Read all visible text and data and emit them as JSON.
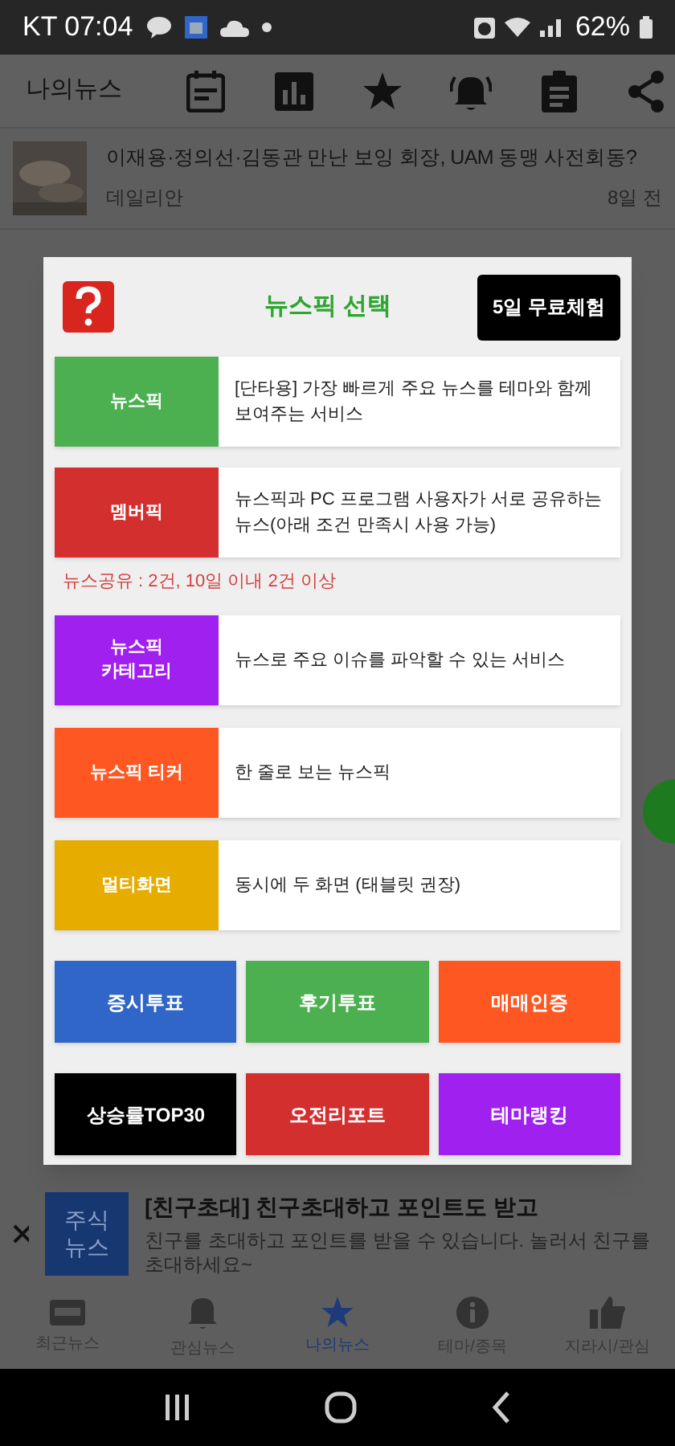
{
  "status_bar": {
    "carrier_time": "KT 07:04",
    "battery": "62%"
  },
  "header": {
    "title": "나의뉴스"
  },
  "news": [
    {
      "title": "이재용·정의선·김동관 만난 보잉 회장, UAM 동맹 사전회동?",
      "source": "데일리안",
      "time": "8일 전"
    }
  ],
  "dialog": {
    "title": "뉴스픽 선택",
    "trial_button": "5일 무료체험",
    "services": [
      {
        "label": "뉴스픽",
        "description": "[단타용] 가장 빠르게 주요 뉴스를 테마와 함께 보여주는 서비스",
        "color": "#4caf50"
      },
      {
        "label": "멤버픽",
        "description": "뉴스픽과 PC 프로그램 사용자가 서로 공유하는 뉴스(아래 조건 만족시 사용 가능)",
        "color": "#d32f2f",
        "note": "뉴스공유 : 2건, 10일 이내 2건 이상"
      },
      {
        "label": "뉴스픽\n카테고리",
        "description": "뉴스로 주요 이슈를 파악할 수 있는 서비스",
        "color": "#a020f0"
      },
      {
        "label": "뉴스픽 티커",
        "description": "한 줄로 보는 뉴스픽",
        "color": "#ff5722"
      },
      {
        "label": "멀티화면",
        "description": "동시에 두 화면 (태블릿 권장)",
        "color": "#e6ac00"
      }
    ],
    "buttons": [
      {
        "label": "증시투표",
        "color": "#2f66c8"
      },
      {
        "label": "후기투표",
        "color": "#4caf50"
      },
      {
        "label": "매매인증",
        "color": "#ff5722"
      },
      {
        "label": "상승률TOP30",
        "color": "#000000"
      },
      {
        "label": "오전리포트",
        "color": "#d32f2f"
      },
      {
        "label": "테마랭킹",
        "color": "#a020f0"
      }
    ]
  },
  "banner": {
    "logo": "주식\n뉴스",
    "title": "[친구초대] 친구초대하고 포인트도 받고",
    "text": "친구를 초대하고 포인트를 받을 수 있습니다. 놀러서 친구를 초대하세요~"
  },
  "bottom_nav": [
    {
      "label": "최근뉴스",
      "selected": false
    },
    {
      "label": "관심뉴스",
      "selected": false
    },
    {
      "label": "나의뉴스",
      "selected": true
    },
    {
      "label": "테마/종목",
      "selected": false
    },
    {
      "label": "지라시/관심",
      "selected": false
    }
  ]
}
